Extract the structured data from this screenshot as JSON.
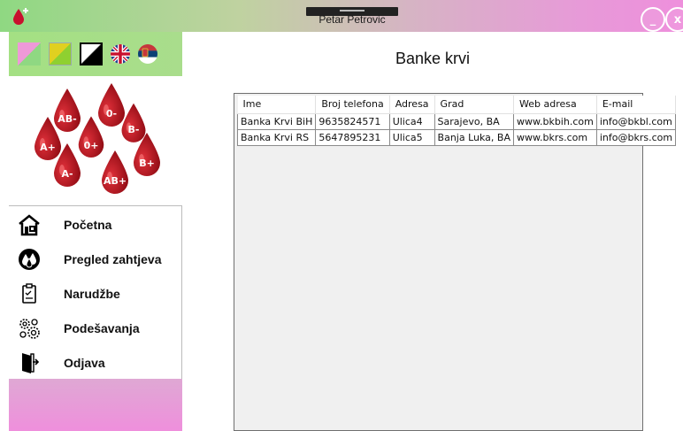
{
  "window": {
    "title": "Petar Petrovic",
    "minimize_label": "_",
    "close_label": "x"
  },
  "theme_colors": {
    "accent_green": "#a4e083",
    "accent_pink": "#ee8fdc"
  },
  "logo": {
    "drops": [
      "AB-",
      "0-",
      "B-",
      "A+",
      "0+",
      "B+",
      "A-",
      "AB+"
    ]
  },
  "nav": {
    "items": [
      {
        "label": "Početna",
        "icon": "home-icon"
      },
      {
        "label": "Pregled zahtjeva",
        "icon": "blood-drops-icon"
      },
      {
        "label": "Narudžbe",
        "icon": "clipboard-icon"
      },
      {
        "label": "Podešavanja",
        "icon": "gears-icon"
      },
      {
        "label": "Odjava",
        "icon": "exit-door-icon"
      }
    ]
  },
  "main": {
    "title": "Banke krvi"
  },
  "table": {
    "columns": [
      "Ime",
      "Broj telefona",
      "Adresa",
      "Grad",
      "Web adresa",
      "E-mail"
    ],
    "rows": [
      [
        "Banka Krvi BiH",
        "9635824571",
        "Ulica4",
        "Sarajevo, BA",
        "www.bkbih.com",
        "info@bkbl.com"
      ],
      [
        "Banka Krvi RS",
        "5647895231",
        "Ulica5",
        "Banja Luka, BA",
        "www.bkrs.com",
        "info@bkrs.com"
      ]
    ]
  }
}
